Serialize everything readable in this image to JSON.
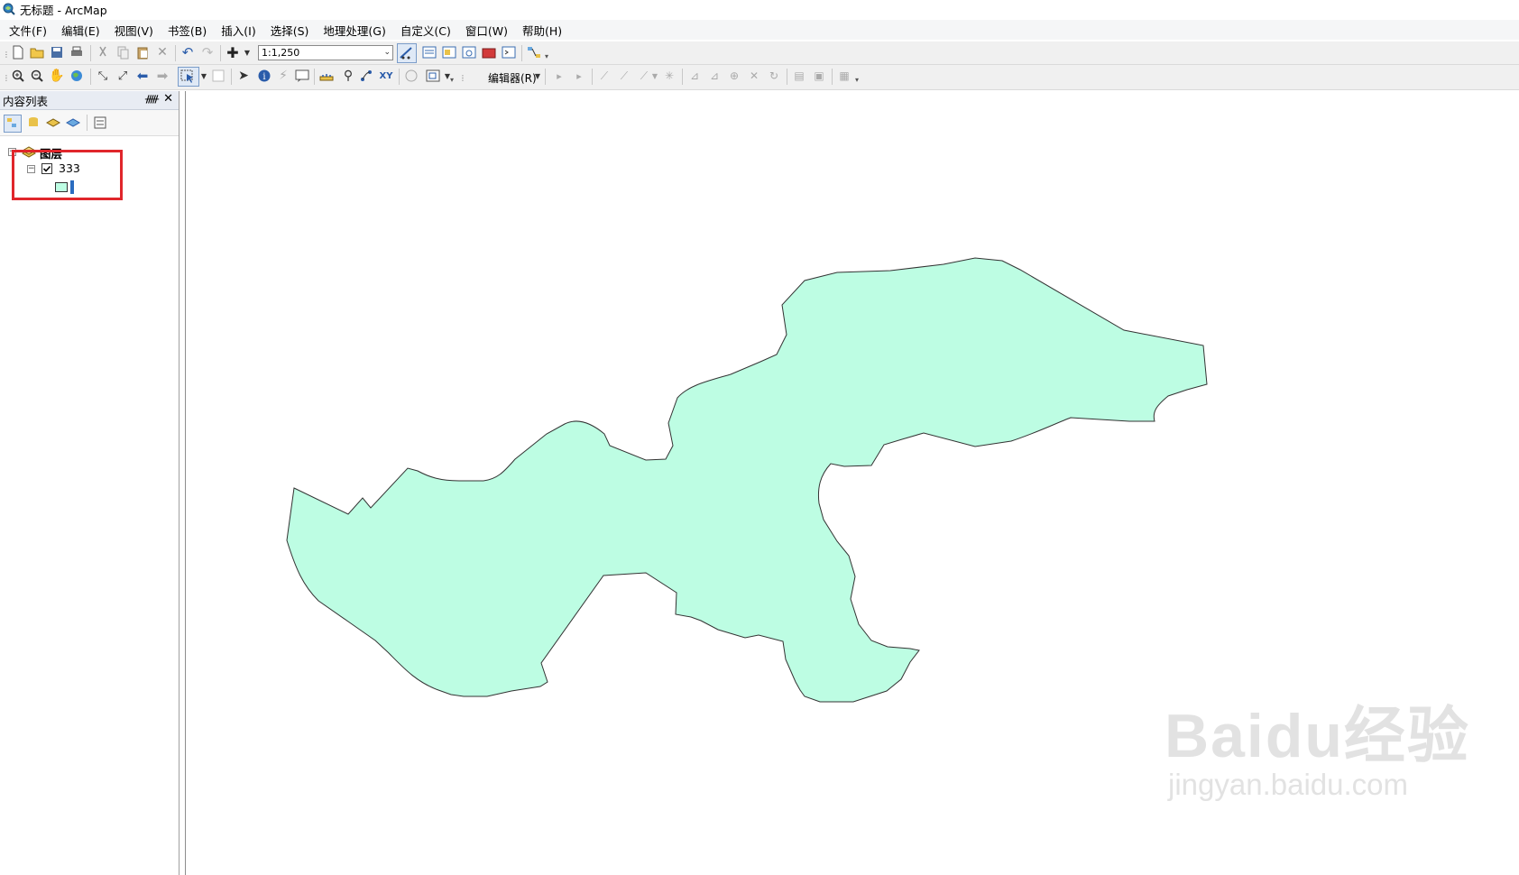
{
  "window": {
    "title": "无标题 - ArcMap"
  },
  "menu": {
    "items": [
      "文件(F)",
      "编辑(E)",
      "视图(V)",
      "书签(B)",
      "插入(I)",
      "选择(S)",
      "地理处理(G)",
      "自定义(C)",
      "窗口(W)",
      "帮助(H)"
    ]
  },
  "toolbar": {
    "scale_value": "1:1,250",
    "editor_label": "编辑器(R)"
  },
  "toc": {
    "title": "内容列表",
    "root_layer": "图层",
    "layer_name": "333",
    "layer_checked": true
  },
  "map": {
    "fill_color": "#bdfde3",
    "outline_color": "#333333"
  },
  "watermark": {
    "logo": "Baidu经验",
    "url": "jingyan.baidu.com"
  },
  "colors": {
    "highlight_box": "#e0262b",
    "panel_header": "#e8ecf3"
  }
}
